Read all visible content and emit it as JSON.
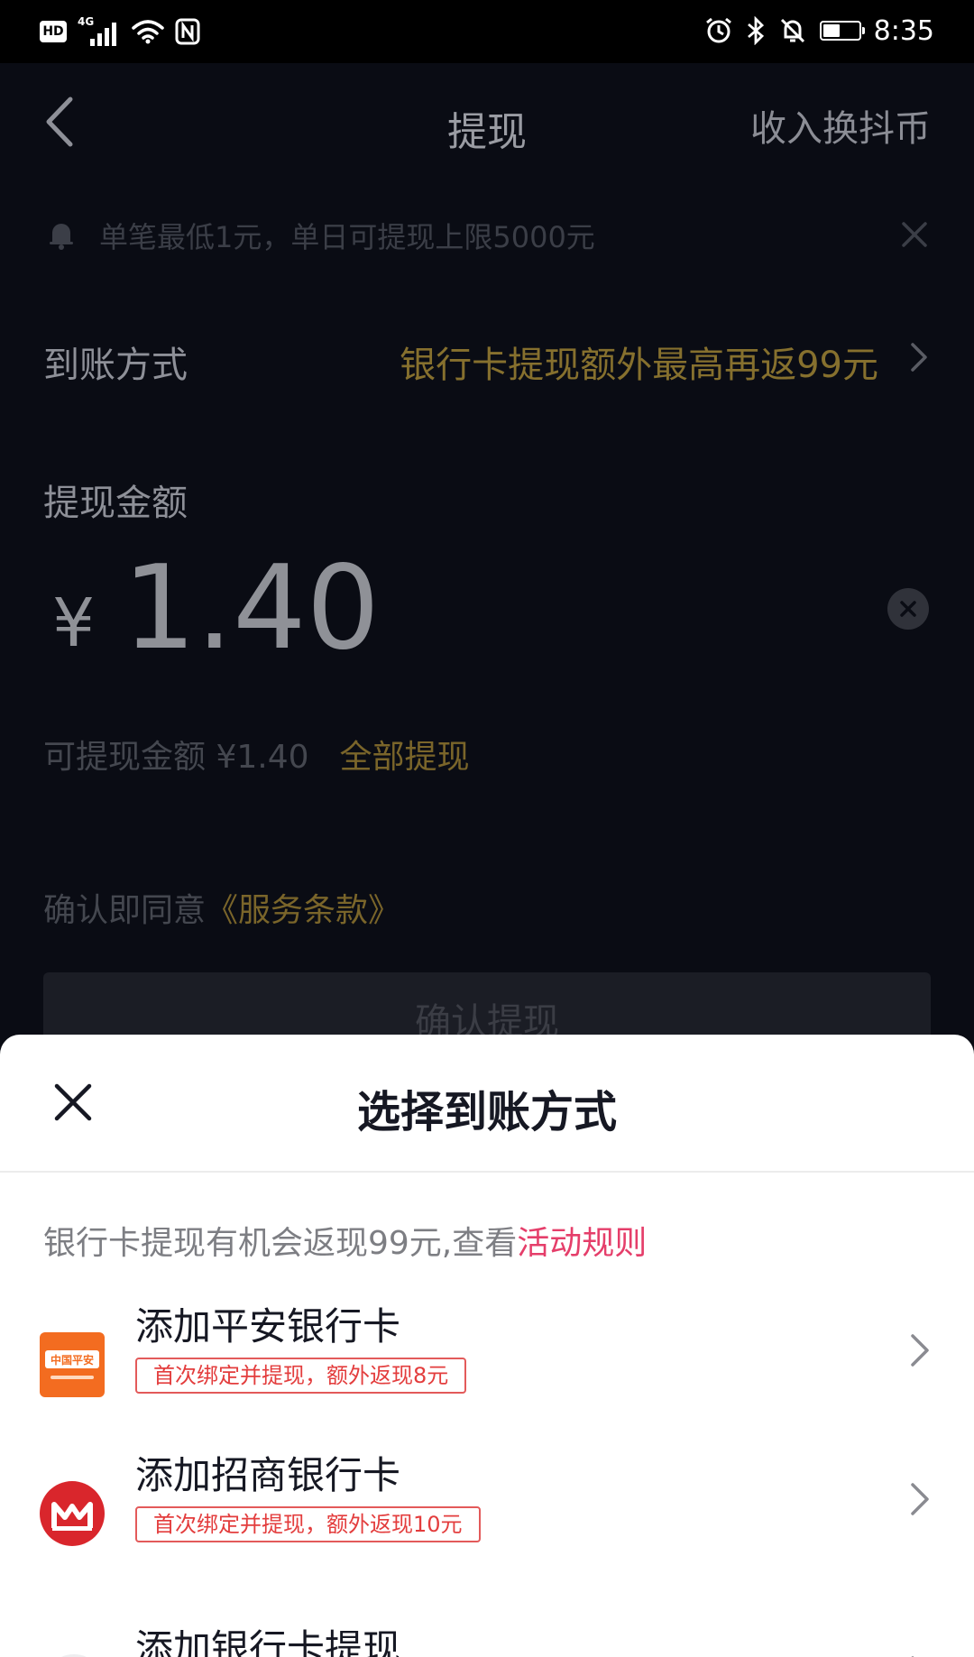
{
  "status_bar": {
    "hd": "HD",
    "network": "4G",
    "time": "8:35"
  },
  "nav": {
    "title": "提现",
    "right_action": "收入换抖币"
  },
  "notice": {
    "text": "单笔最低1元，单日可提现上限5000元"
  },
  "payout_method": {
    "label": "到账方式",
    "promo": "银行卡提现额外最高再返99元"
  },
  "amount": {
    "label": "提现金额",
    "currency": "¥",
    "value": "1.40"
  },
  "available": {
    "text": "可提现金额 ¥1.40",
    "withdraw_all": "全部提现"
  },
  "terms": {
    "prefix": "确认即同意",
    "link": "《服务条款》"
  },
  "confirm_button": "确认提现",
  "sheet": {
    "title": "选择到账方式",
    "promo_text": "银行卡提现有机会返现99元,查看",
    "promo_link": "活动规则",
    "banks": [
      {
        "name": "添加平安银行卡",
        "tag": "首次绑定并提现，额外返现8元",
        "logo_text": "中国平安"
      },
      {
        "name": "添加招商银行卡",
        "tag": "首次绑定并提现，额外返现10元"
      }
    ],
    "add_card": "添加银行卡提现"
  },
  "colors": {
    "gold": "#86702e",
    "link_pink": "#e53e6a",
    "tag_red": "#e33d3d",
    "pingan_orange": "#f36c20",
    "cmb_red": "#d9262c"
  }
}
